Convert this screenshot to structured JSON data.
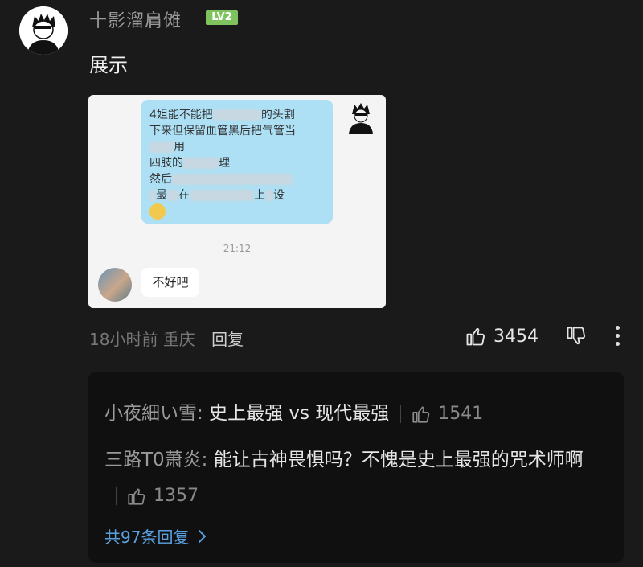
{
  "comment": {
    "username": "十影溜肩傩",
    "level": "LV2",
    "text": "展示",
    "time": "18小时前",
    "location": "重庆",
    "reply_label": "回复",
    "likes": "3454"
  },
  "screenshot": {
    "chat_lines": [
      "4姐能不能把",
      "下来但保留血管黑后把气管当",
      "用",
      "四肢的",
      "然后",
      "最",
      "在"
    ],
    "chat_visible_fragments": [
      "的头割",
      "理",
      "上",
      "设"
    ],
    "timestamp": "21:12",
    "reply_bubble": "不好吧"
  },
  "replies": [
    {
      "user": "小夜細い雪:",
      "text": "史上最强 vs 现代最强",
      "likes": "1541"
    },
    {
      "user": "三路T0萧炎:",
      "text": "能让古神畏惧吗？不愧是史上最强的咒术师啊",
      "likes": "1357"
    }
  ],
  "total_replies": "共97条回复",
  "colors": {
    "background": "#1a1a1a",
    "reply_box": "#101010",
    "level_badge": "#7fc35e",
    "link": "#5aa0e0",
    "bubble_blue": "#aee0f5"
  },
  "icons": {
    "like": "thumbs-up-icon",
    "dislike": "thumbs-down-icon",
    "more": "more-vertical-icon",
    "chevron": "chevron-right-icon"
  }
}
